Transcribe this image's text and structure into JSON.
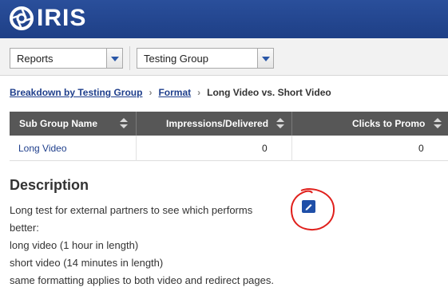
{
  "app": {
    "logo_text": "IRIS",
    "brand_color": "#1e3f86"
  },
  "toolbar": {
    "report_select": "Reports",
    "group_select": "Testing Group"
  },
  "breadcrumb": {
    "items": [
      "Breakdown by Testing Group",
      "Format"
    ],
    "current": "Long Video vs. Short Video"
  },
  "table": {
    "columns": [
      "Sub Group Name",
      "Impressions/Delivered",
      "Clicks to Promo"
    ],
    "rows": [
      {
        "name": "Long Video",
        "impressions": "0",
        "clicks": "0"
      }
    ]
  },
  "description": {
    "title": "Description",
    "lines": [
      "Long test for external partners to see which performs",
      "better:",
      "long video (1 hour in length)",
      "short video (14 minutes in length)",
      "same formatting applies to both video and redirect pages."
    ],
    "edit_icon": "pencil-icon",
    "annotation_color": "#e0201c"
  }
}
